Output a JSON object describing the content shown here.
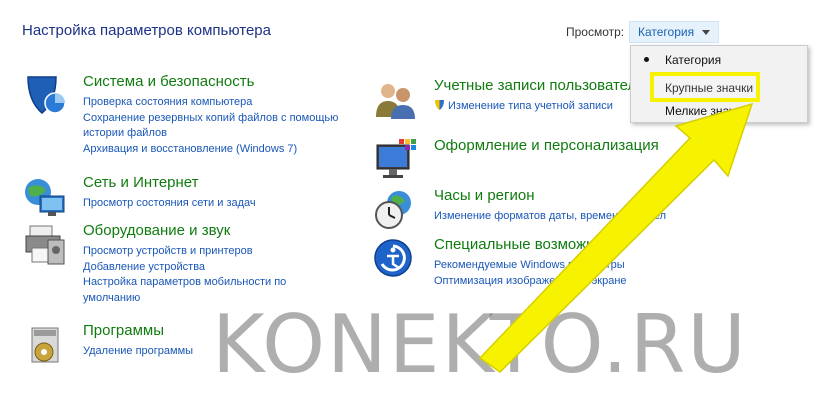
{
  "header": {
    "title": "Настройка параметров компьютера",
    "view_label": "Просмотр:",
    "view_value": "Категория"
  },
  "view_menu": {
    "items": [
      {
        "label": "Категория",
        "selected": true
      },
      {
        "label": "Крупные значки",
        "selected": false
      },
      {
        "label": "Мелкие значки",
        "selected": false
      }
    ]
  },
  "categories": [
    {
      "title": "Система и безопасность",
      "icon": "shield-icon",
      "links": [
        "Проверка состояния компьютера",
        "Сохранение резервных копий файлов с помощью",
        "истории файлов",
        "Архивация и восстановление (Windows 7)"
      ]
    },
    {
      "title": "Сеть и Интернет",
      "icon": "network-icon",
      "links": [
        "Просмотр состояния сети и задач"
      ]
    },
    {
      "title": "Оборудование и звук",
      "icon": "printer-icon",
      "links": [
        "Просмотр устройств и принтеров",
        "Добавление устройства",
        "Настройка параметров мобильности по",
        "умолчанию"
      ]
    },
    {
      "title": "Программы",
      "icon": "programs-icon",
      "links": [
        "Удаление программы"
      ]
    },
    {
      "title": "Учетные записи пользователей",
      "icon": "users-icon",
      "links": [
        "Изменение типа учетной записи"
      ]
    },
    {
      "title": "Оформление и персонализация",
      "icon": "display-icon",
      "links": []
    },
    {
      "title": "Часы и регион",
      "icon": "clock-icon",
      "links": [
        "Изменение форматов даты, времени и чисел"
      ]
    },
    {
      "title": "Специальные возможности",
      "icon": "accessibility-icon",
      "links": [
        "Рекомендуемые Windows параметры",
        "Оптимизация изображения на экране"
      ]
    }
  ],
  "watermark": "KONEKTO.RU",
  "colors": {
    "accent_link": "#1a57b8",
    "category_title": "#107c10",
    "highlight": "#f7f200"
  }
}
